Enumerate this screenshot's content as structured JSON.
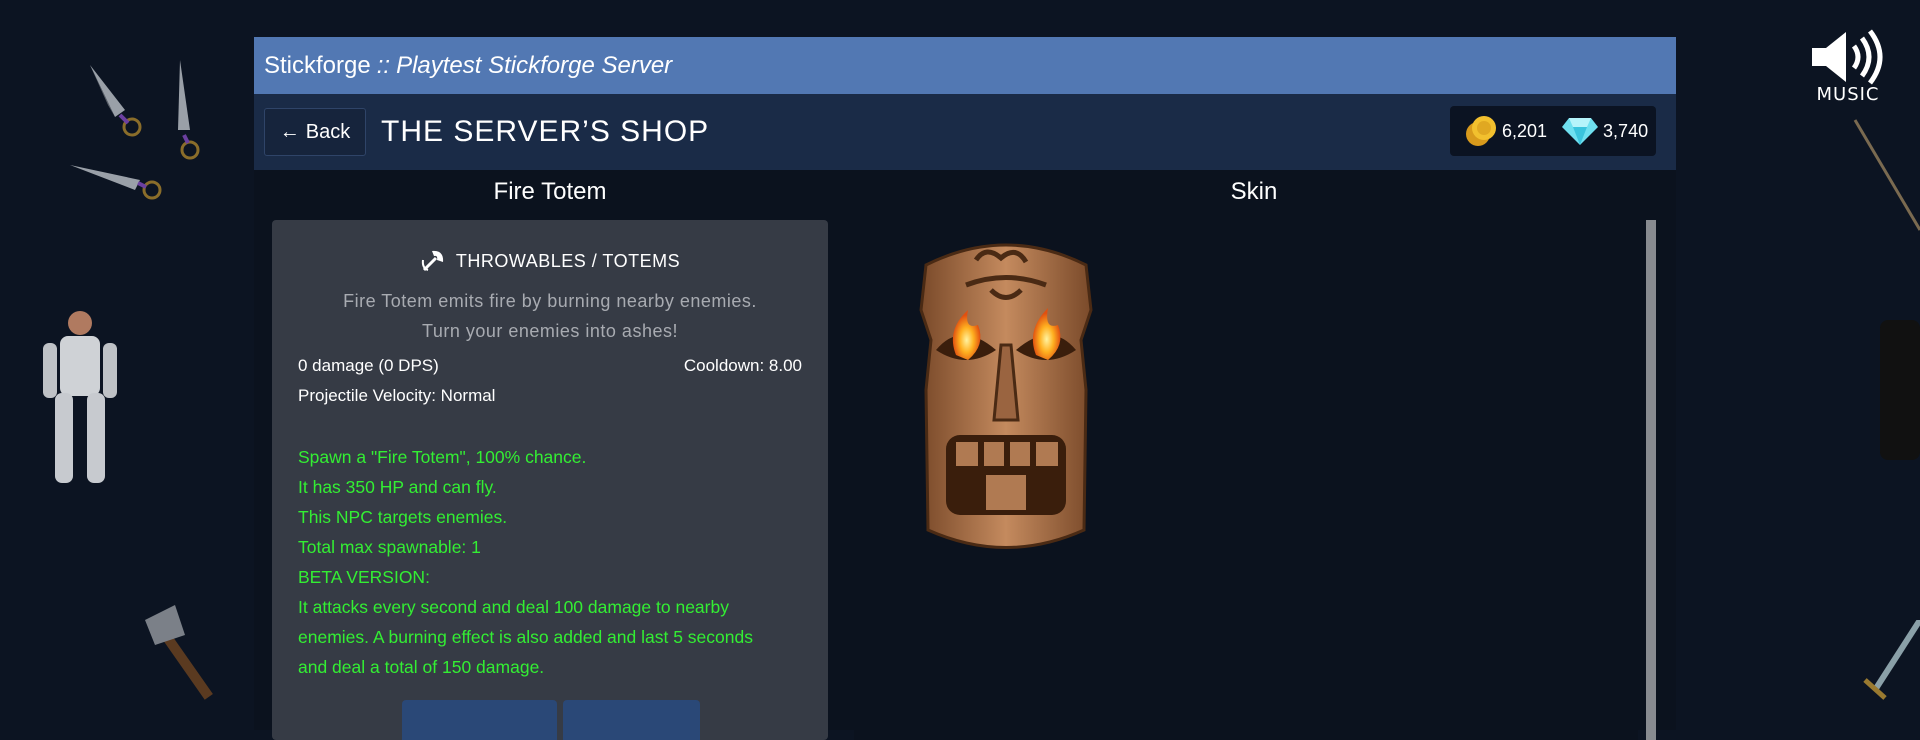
{
  "music": {
    "label": "MUSIC"
  },
  "window": {
    "app_name": "Stickforge",
    "separator": "::",
    "server_name": "Playtest Stickforge Server"
  },
  "header": {
    "back_label": "Back",
    "title": "THE SERVER’S SHOP"
  },
  "currency": {
    "gold": "6,201",
    "gems": "3,740",
    "gold_icon": "gold-coin-icon",
    "gem_icon": "diamond-icon"
  },
  "item": {
    "name": "Fire Totem",
    "category_icon": "axe-icon",
    "category": "THROWABLES / TOTEMS",
    "description_line1": "Fire Totem emits fire by burning nearby enemies.",
    "description_line2": "Turn your enemies into ashes!",
    "damage": "0 damage (0 DPS)",
    "cooldown": "Cooldown: 8.00",
    "velocity": "Projectile Velocity: Normal",
    "effects": [
      "Spawn a \"Fire Totem\", 100% chance.",
      "It has 350 HP and can fly.",
      "This NPC targets enemies.",
      "Total max spawnable: 1",
      "BETA VERSION:",
      "It attacks every second and deal 100 damage to nearby",
      "enemies. A burning effect is also added and last 5 seconds",
      "and deal a total of 150 damage."
    ]
  },
  "preview": {
    "title": "Skin",
    "image": "fire-totem-skin"
  },
  "colors": {
    "title_bar": "#5278b3",
    "header_bar": "#1a2b47",
    "effect_text": "#33ee33",
    "card": "#363b45"
  }
}
